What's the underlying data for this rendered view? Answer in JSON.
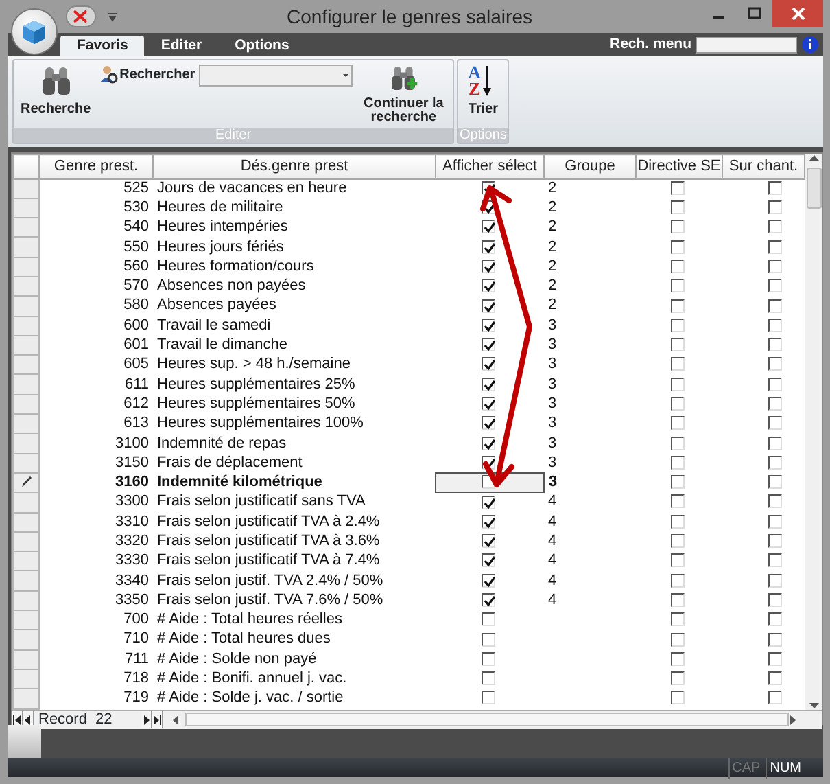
{
  "window": {
    "title": "Configurer le genres salaires"
  },
  "tabs": [
    {
      "label": "Favoris",
      "selected": true
    },
    {
      "label": "Editer",
      "selected": false
    },
    {
      "label": "Options",
      "selected": false
    }
  ],
  "menu_search": {
    "label": "Rech. menu"
  },
  "ribbon": [
    {
      "label": "Editer",
      "items": [
        {
          "kind": "binoculars",
          "label": "Recherche"
        },
        {
          "kind": "combo",
          "label": "Rechercher"
        },
        {
          "kind": "binoculars-plus",
          "label": "Continuer la recherche"
        }
      ]
    },
    {
      "label": "Options",
      "items": [
        {
          "kind": "sort",
          "label": "Trier",
          "glyphs": [
            "A",
            "Z"
          ]
        }
      ]
    }
  ],
  "grid": {
    "columns": [
      "Genre prest.",
      "Dés.genre prest",
      "Afficher sélect",
      "Groupe",
      "Directive SE",
      "Sur chant."
    ],
    "rows": [
      {
        "code": "525",
        "name": "Jours de vacances en heure",
        "show": true,
        "group": "2",
        "directive": false,
        "site": false,
        "editing": false
      },
      {
        "code": "530",
        "name": "Heures de militaire",
        "show": true,
        "group": "2",
        "directive": false,
        "site": false,
        "editing": false
      },
      {
        "code": "540",
        "name": "Heures intempéries",
        "show": true,
        "group": "2",
        "directive": false,
        "site": false,
        "editing": false
      },
      {
        "code": "550",
        "name": "Heures jours fériés",
        "show": true,
        "group": "2",
        "directive": false,
        "site": false,
        "editing": false
      },
      {
        "code": "560",
        "name": "Heures formation/cours",
        "show": true,
        "group": "2",
        "directive": false,
        "site": false,
        "editing": false
      },
      {
        "code": "570",
        "name": "Absences non payées",
        "show": true,
        "group": "2",
        "directive": false,
        "site": false,
        "editing": false
      },
      {
        "code": "580",
        "name": "Absences payées",
        "show": true,
        "group": "2",
        "directive": false,
        "site": false,
        "editing": false
      },
      {
        "code": "600",
        "name": "Travail le samedi",
        "show": true,
        "group": "3",
        "directive": false,
        "site": false,
        "editing": false
      },
      {
        "code": "601",
        "name": "Travail le dimanche",
        "show": true,
        "group": "3",
        "directive": false,
        "site": false,
        "editing": false
      },
      {
        "code": "605",
        "name": "Heures sup. > 48 h./semaine",
        "show": true,
        "group": "3",
        "directive": false,
        "site": false,
        "editing": false
      },
      {
        "code": "611",
        "name": "Heures supplémentaires 25%",
        "show": true,
        "group": "3",
        "directive": false,
        "site": false,
        "editing": false
      },
      {
        "code": "612",
        "name": "Heures supplémentaires 50%",
        "show": true,
        "group": "3",
        "directive": false,
        "site": false,
        "editing": false
      },
      {
        "code": "613",
        "name": "Heures supplémentaires 100%",
        "show": true,
        "group": "3",
        "directive": false,
        "site": false,
        "editing": false
      },
      {
        "code": "3100",
        "name": "Indemnité de repas",
        "show": true,
        "group": "3",
        "directive": false,
        "site": false,
        "editing": false
      },
      {
        "code": "3150",
        "name": "Frais de déplacement",
        "show": true,
        "group": "3",
        "directive": false,
        "site": false,
        "editing": false
      },
      {
        "code": "3160",
        "name": "Indemnité kilométrique",
        "show": false,
        "group": "3",
        "directive": false,
        "site": false,
        "editing": true
      },
      {
        "code": "3300",
        "name": "Frais selon justificatif sans TVA",
        "show": true,
        "group": "4",
        "directive": false,
        "site": false,
        "editing": false
      },
      {
        "code": "3310",
        "name": "Frais selon justificatif TVA à 2.4%",
        "show": true,
        "group": "4",
        "directive": false,
        "site": false,
        "editing": false
      },
      {
        "code": "3320",
        "name": "Frais selon justificatif TVA à 3.6%",
        "show": true,
        "group": "4",
        "directive": false,
        "site": false,
        "editing": false
      },
      {
        "code": "3330",
        "name": "Frais selon justificatif TVA à 7.4%",
        "show": true,
        "group": "4",
        "directive": false,
        "site": false,
        "editing": false
      },
      {
        "code": "3340",
        "name": "Frais selon justif. TVA 2.4% / 50%",
        "show": true,
        "group": "4",
        "directive": false,
        "site": false,
        "editing": false
      },
      {
        "code": "3350",
        "name": "Frais selon justif. TVA 7.6% / 50%",
        "show": true,
        "group": "4",
        "directive": false,
        "site": false,
        "editing": false
      },
      {
        "code": "700",
        "name": "# Aide : Total heures réelles",
        "show": false,
        "directive": false,
        "site": false,
        "editing": false
      },
      {
        "code": "710",
        "name": "# Aide : Total heures dues",
        "show": false,
        "directive": false,
        "site": false,
        "editing": false
      },
      {
        "code": "711",
        "name": "# Aide : Solde non payé",
        "show": false,
        "directive": false,
        "site": false,
        "editing": false
      },
      {
        "code": "718",
        "name": "# Aide : Bonifi. annuel j. vac.",
        "show": false,
        "directive": false,
        "site": false,
        "editing": false
      },
      {
        "code": "719",
        "name": "# Aide : Solde j. vac. / sortie",
        "show": false,
        "directive": false,
        "site": false,
        "editing": false
      }
    ]
  },
  "navigation": {
    "label": "Record",
    "value": "22"
  },
  "status_bar": [
    {
      "label": "CAP",
      "on": false
    },
    {
      "label": "NUM",
      "on": true
    }
  ]
}
